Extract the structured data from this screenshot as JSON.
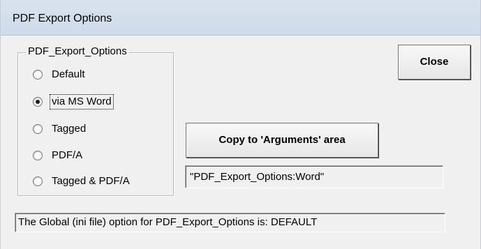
{
  "window": {
    "title": "PDF Export Options"
  },
  "group": {
    "legend": "PDF_Export_Options",
    "options": [
      {
        "label": "Default",
        "checked": false
      },
      {
        "label": "via MS Word",
        "checked": true
      },
      {
        "label": "Tagged",
        "checked": false
      },
      {
        "label": "PDF/A",
        "checked": false
      },
      {
        "label": "Tagged & PDF/A",
        "checked": false
      }
    ]
  },
  "buttons": {
    "close_label": "Close",
    "copy_label": "Copy to 'Arguments' area"
  },
  "arguments_field": {
    "value": "\"PDF_Export_Options:Word\""
  },
  "status": {
    "text": "The Global (ini file) option for PDF_Export_Options is: DEFAULT"
  }
}
